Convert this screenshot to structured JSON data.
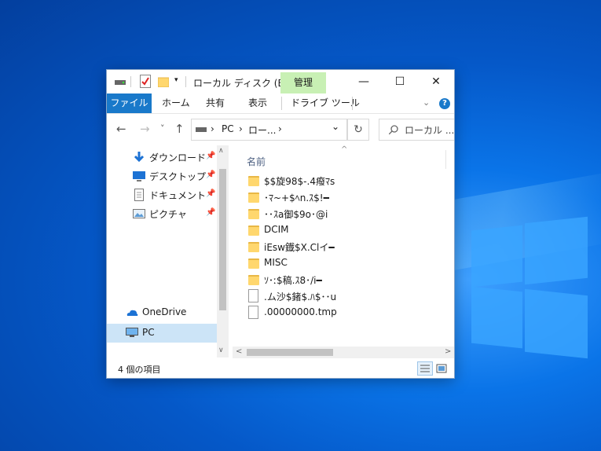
{
  "window": {
    "title": "ローカル ディスク (E:)",
    "manage_tab": "管理",
    "controls": {
      "minimize": "—",
      "maximize": "☐",
      "close": "✕"
    }
  },
  "ribbon": {
    "tabs": [
      "ファイル",
      "ホーム",
      "共有",
      "表示",
      "ドライブ ツール"
    ],
    "collapse_icon": "chevron-down-icon",
    "help": "?"
  },
  "nav": {
    "back": "←",
    "forward": "→",
    "recent": "˅",
    "up": "↑",
    "address": {
      "pc": "PC",
      "sep": "›",
      "drive": "ロー...",
      "dropdown": "⌄"
    },
    "refresh": "↻",
    "search_placeholder": "ローカル ..."
  },
  "sidebar": {
    "items": [
      {
        "label": "ダウンロード",
        "icon": "download-icon",
        "pinned": true
      },
      {
        "label": "デスクトップ",
        "icon": "desktop-icon",
        "pinned": true
      },
      {
        "label": "ドキュメント",
        "icon": "document-icon",
        "pinned": true
      },
      {
        "label": "ピクチャ",
        "icon": "pictures-icon",
        "pinned": true
      },
      {
        "label": "OneDrive",
        "icon": "onedrive-icon",
        "pinned": false
      },
      {
        "label": "PC",
        "icon": "pc-icon",
        "pinned": false,
        "selected": true
      }
    ]
  },
  "content": {
    "column_name": "名前",
    "files": [
      {
        "name": "$$旋98$-.4癈ﾏs",
        "type": "folder"
      },
      {
        "name": "･ﾏ~+$ﾍn.ｽ$!━",
        "type": "folder"
      },
      {
        "name": "･･ｽa御$9o･@i",
        "type": "folder"
      },
      {
        "name": "DCIM",
        "type": "folder"
      },
      {
        "name": "iEsw鐡$X.Clイ━",
        "type": "folder"
      },
      {
        "name": "MISC",
        "type": "folder"
      },
      {
        "name": "ｿ･ː$稿.ｽ8･/i━",
        "type": "folder"
      },
      {
        "name": ".ム沙$鍺$.ﾊ$･･u",
        "type": "file"
      },
      {
        "name": ".00000000.tmp",
        "type": "file"
      }
    ]
  },
  "status": {
    "item_count": "4 個の項目"
  },
  "colors": {
    "accent": "#1979ca",
    "manage_tab_bg": "#c8f0b4",
    "selected_bg": "#cce4f7"
  }
}
